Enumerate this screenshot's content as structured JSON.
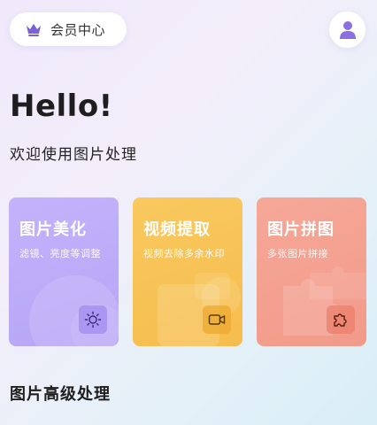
{
  "header": {
    "member_label": "会员中心",
    "crown_icon": "crown-icon",
    "avatar_icon": "user-icon"
  },
  "greeting": {
    "hello": "Hello!",
    "welcome": "欢迎使用图片处理"
  },
  "cards": [
    {
      "title": "图片美化",
      "subtitle": "滤镜、亮度等调整",
      "icon": "brightness-icon",
      "color": "#bdaef9"
    },
    {
      "title": "视频提取",
      "subtitle": "视频去除多余水印",
      "icon": "video-camera-icon",
      "color": "#f8c357"
    },
    {
      "title": "图片拼图",
      "subtitle": "多张图片拼接",
      "icon": "puzzle-icon",
      "color": "#f4a191"
    }
  ],
  "section": {
    "advanced_title": "图片高级处理"
  },
  "colors": {
    "accent": "#8b6fe0",
    "crown": "#7b5fd6"
  }
}
